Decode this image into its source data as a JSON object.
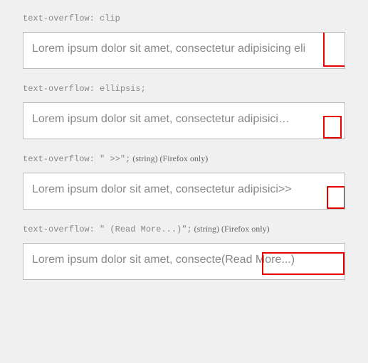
{
  "examples": [
    {
      "label_code": "text-overflow: clip",
      "label_note": "",
      "display_text": "Lorem ipsum dolor sit amet, consectetur adipisicing eli",
      "highlight_class": "h1"
    },
    {
      "label_code": "text-overflow: ellipsis;",
      "label_note": "",
      "display_text": "Lorem ipsum dolor sit amet, consectetur adipisici…",
      "highlight_class": "h2"
    },
    {
      "label_code": "text-overflow: \" >>\";",
      "label_note": " (string) (Firefox only)",
      "display_text": "Lorem ipsum dolor sit amet, consectetur adipisici>>",
      "highlight_class": "h3"
    },
    {
      "label_code": "text-overflow: \" (Read More...)\";",
      "label_note": " (string) (Firefox only)",
      "display_text": "Lorem ipsum dolor sit amet, consecte(Read More...)",
      "highlight_class": "h4"
    }
  ]
}
